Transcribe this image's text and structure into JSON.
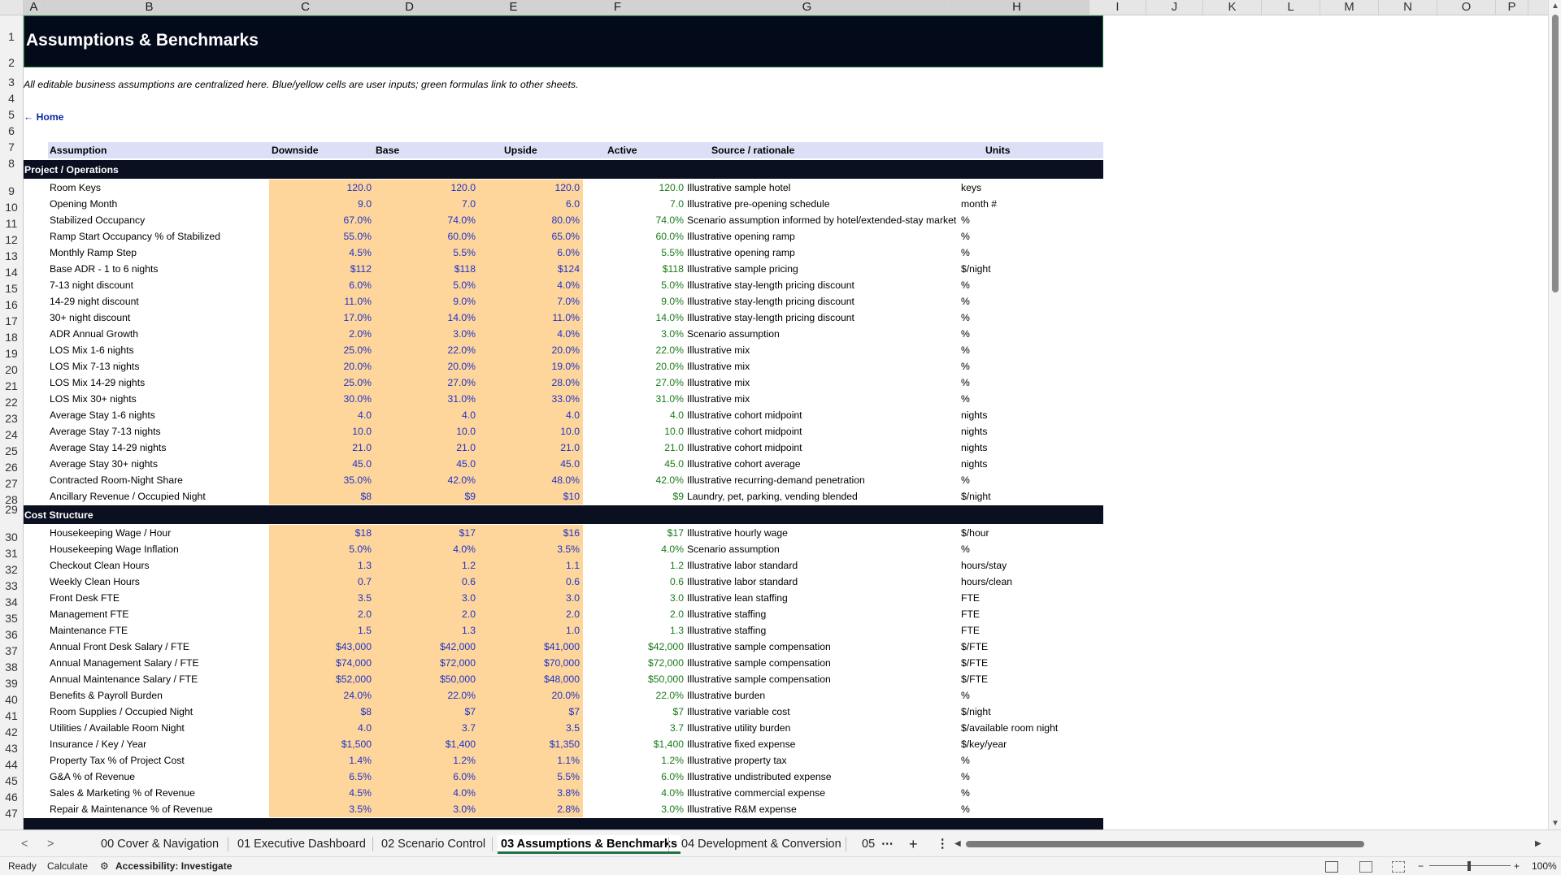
{
  "columns": [
    "A",
    "B",
    "C",
    "D",
    "E",
    "F",
    "G",
    "H",
    "I",
    "J",
    "K",
    "L",
    "M",
    "N",
    "O",
    "P"
  ],
  "title": "Assumptions & Benchmarks",
  "note": "All editable business assumptions are centralized here. Blue/yellow cells are user inputs; green formulas link to other sheets.",
  "home_link": "← Home",
  "table_headers": {
    "assumption": "Assumption",
    "downside": "Downside",
    "base": "Base",
    "upside": "Upside",
    "active": "Active",
    "source": "Source / rationale",
    "units": "Units"
  },
  "sections": {
    "ops": "Project / Operations",
    "cost": "Cost Structure"
  },
  "ops_rows": [
    {
      "row": "9",
      "name": "Room Keys",
      "down": "120.0",
      "base": "120.0",
      "up": "120.0",
      "active": "120.0",
      "source": "Illustrative sample hotel",
      "units": "keys"
    },
    {
      "row": "10",
      "name": "Opening Month",
      "down": "9.0",
      "base": "7.0",
      "up": "6.0",
      "active": "7.0",
      "source": "Illustrative pre-opening schedule",
      "units": "month #"
    },
    {
      "row": "11",
      "name": "Stabilized Occupancy",
      "down": "67.0%",
      "base": "74.0%",
      "up": "80.0%",
      "active": "74.0%",
      "source": "Scenario assumption informed by hotel/extended-stay market",
      "units": "%"
    },
    {
      "row": "12",
      "name": "Ramp Start Occupancy % of Stabilized",
      "down": "55.0%",
      "base": "60.0%",
      "up": "65.0%",
      "active": "60.0%",
      "source": "Illustrative opening ramp",
      "units": "%"
    },
    {
      "row": "13",
      "name": "Monthly Ramp Step",
      "down": "4.5%",
      "base": "5.5%",
      "up": "6.0%",
      "active": "5.5%",
      "source": "Illustrative opening ramp",
      "units": "%"
    },
    {
      "row": "14",
      "name": "Base ADR - 1 to 6 nights",
      "down": "$112",
      "base": "$118",
      "up": "$124",
      "active": "$118",
      "source": "Illustrative sample pricing",
      "units": "$/night"
    },
    {
      "row": "15",
      "name": "7-13 night discount",
      "down": "6.0%",
      "base": "5.0%",
      "up": "4.0%",
      "active": "5.0%",
      "source": "Illustrative stay-length pricing discount",
      "units": "%"
    },
    {
      "row": "16",
      "name": "14-29 night discount",
      "down": "11.0%",
      "base": "9.0%",
      "up": "7.0%",
      "active": "9.0%",
      "source": "Illustrative stay-length pricing discount",
      "units": "%"
    },
    {
      "row": "17",
      "name": "30+ night discount",
      "down": "17.0%",
      "base": "14.0%",
      "up": "11.0%",
      "active": "14.0%",
      "source": "Illustrative stay-length pricing discount",
      "units": "%"
    },
    {
      "row": "18",
      "name": "ADR Annual Growth",
      "down": "2.0%",
      "base": "3.0%",
      "up": "4.0%",
      "active": "3.0%",
      "source": "Scenario assumption",
      "units": "%"
    },
    {
      "row": "19",
      "name": "LOS Mix 1-6 nights",
      "down": "25.0%",
      "base": "22.0%",
      "up": "20.0%",
      "active": "22.0%",
      "source": "Illustrative mix",
      "units": "%"
    },
    {
      "row": "20",
      "name": "LOS Mix 7-13 nights",
      "down": "20.0%",
      "base": "20.0%",
      "up": "19.0%",
      "active": "20.0%",
      "source": "Illustrative mix",
      "units": "%"
    },
    {
      "row": "21",
      "name": "LOS Mix 14-29 nights",
      "down": "25.0%",
      "base": "27.0%",
      "up": "28.0%",
      "active": "27.0%",
      "source": "Illustrative mix",
      "units": "%"
    },
    {
      "row": "22",
      "name": "LOS Mix 30+ nights",
      "down": "30.0%",
      "base": "31.0%",
      "up": "33.0%",
      "active": "31.0%",
      "source": "Illustrative mix",
      "units": "%"
    },
    {
      "row": "23",
      "name": "Average Stay 1-6 nights",
      "down": "4.0",
      "base": "4.0",
      "up": "4.0",
      "active": "4.0",
      "source": "Illustrative cohort midpoint",
      "units": "nights"
    },
    {
      "row": "24",
      "name": "Average Stay 7-13 nights",
      "down": "10.0",
      "base": "10.0",
      "up": "10.0",
      "active": "10.0",
      "source": "Illustrative cohort midpoint",
      "units": "nights"
    },
    {
      "row": "25",
      "name": "Average Stay 14-29 nights",
      "down": "21.0",
      "base": "21.0",
      "up": "21.0",
      "active": "21.0",
      "source": "Illustrative cohort midpoint",
      "units": "nights"
    },
    {
      "row": "26",
      "name": "Average Stay 30+ nights",
      "down": "45.0",
      "base": "45.0",
      "up": "45.0",
      "active": "45.0",
      "source": "Illustrative cohort average",
      "units": "nights"
    },
    {
      "row": "27",
      "name": "Contracted Room-Night Share",
      "down": "35.0%",
      "base": "42.0%",
      "up": "48.0%",
      "active": "42.0%",
      "source": "Illustrative recurring-demand penetration",
      "units": "%"
    },
    {
      "row": "28",
      "name": "Ancillary Revenue / Occupied Night",
      "down": "$8",
      "base": "$9",
      "up": "$10",
      "active": "$9",
      "source": "Laundry, pet, parking, vending blended",
      "units": "$/night"
    }
  ],
  "cost_rows": [
    {
      "row": "30",
      "name": "Housekeeping Wage / Hour",
      "down": "$18",
      "base": "$17",
      "up": "$16",
      "active": "$17",
      "source": "Illustrative hourly wage",
      "units": "$/hour"
    },
    {
      "row": "31",
      "name": "Housekeeping Wage Inflation",
      "down": "5.0%",
      "base": "4.0%",
      "up": "3.5%",
      "active": "4.0%",
      "source": "Scenario assumption",
      "units": "%"
    },
    {
      "row": "32",
      "name": "Checkout Clean Hours",
      "down": "1.3",
      "base": "1.2",
      "up": "1.1",
      "active": "1.2",
      "source": "Illustrative labor standard",
      "units": "hours/stay"
    },
    {
      "row": "33",
      "name": "Weekly Clean Hours",
      "down": "0.7",
      "base": "0.6",
      "up": "0.6",
      "active": "0.6",
      "source": "Illustrative labor standard",
      "units": "hours/clean"
    },
    {
      "row": "34",
      "name": "Front Desk FTE",
      "down": "3.5",
      "base": "3.0",
      "up": "3.0",
      "active": "3.0",
      "source": "Illustrative lean staffing",
      "units": "FTE"
    },
    {
      "row": "35",
      "name": "Management FTE",
      "down": "2.0",
      "base": "2.0",
      "up": "2.0",
      "active": "2.0",
      "source": "Illustrative staffing",
      "units": "FTE"
    },
    {
      "row": "36",
      "name": "Maintenance FTE",
      "down": "1.5",
      "base": "1.3",
      "up": "1.0",
      "active": "1.3",
      "source": "Illustrative staffing",
      "units": "FTE"
    },
    {
      "row": "37",
      "name": "Annual Front Desk Salary / FTE",
      "down": "$43,000",
      "base": "$42,000",
      "up": "$41,000",
      "active": "$42,000",
      "source": "Illustrative sample compensation",
      "units": "$/FTE"
    },
    {
      "row": "38",
      "name": "Annual Management Salary / FTE",
      "down": "$74,000",
      "base": "$72,000",
      "up": "$70,000",
      "active": "$72,000",
      "source": "Illustrative sample compensation",
      "units": "$/FTE"
    },
    {
      "row": "39",
      "name": "Annual Maintenance Salary / FTE",
      "down": "$52,000",
      "base": "$50,000",
      "up": "$48,000",
      "active": "$50,000",
      "source": "Illustrative sample compensation",
      "units": "$/FTE"
    },
    {
      "row": "40",
      "name": "Benefits & Payroll Burden",
      "down": "24.0%",
      "base": "22.0%",
      "up": "20.0%",
      "active": "22.0%",
      "source": "Illustrative burden",
      "units": "%"
    },
    {
      "row": "41",
      "name": "Room Supplies / Occupied Night",
      "down": "$8",
      "base": "$7",
      "up": "$7",
      "active": "$7",
      "source": "Illustrative variable cost",
      "units": "$/night"
    },
    {
      "row": "42",
      "name": "Utilities / Available Room Night",
      "down": "4.0",
      "base": "3.7",
      "up": "3.5",
      "active": "3.7",
      "source": "Illustrative utility burden",
      "units": "$/available room night"
    },
    {
      "row": "43",
      "name": "Insurance / Key / Year",
      "down": "$1,500",
      "base": "$1,400",
      "up": "$1,350",
      "active": "$1,400",
      "source": "Illustrative fixed expense",
      "units": "$/key/year"
    },
    {
      "row": "44",
      "name": "Property Tax % of Project Cost",
      "down": "1.4%",
      "base": "1.2%",
      "up": "1.1%",
      "active": "1.2%",
      "source": "Illustrative property tax",
      "units": "%"
    },
    {
      "row": "45",
      "name": "G&A % of Revenue",
      "down": "6.5%",
      "base": "6.0%",
      "up": "5.5%",
      "active": "6.0%",
      "source": "Illustrative undistributed expense",
      "units": "%"
    },
    {
      "row": "46",
      "name": "Sales & Marketing % of Revenue",
      "down": "4.5%",
      "base": "4.0%",
      "up": "3.8%",
      "active": "4.0%",
      "source": "Illustrative commercial expense",
      "units": "%"
    },
    {
      "row": "47",
      "name": "Repair & Maintenance % of Revenue",
      "down": "3.5%",
      "base": "3.0%",
      "up": "2.8%",
      "active": "3.0%",
      "source": "Illustrative R&M expense",
      "units": "%"
    }
  ],
  "tabs": [
    "00 Cover & Navigation",
    "01 Executive Dashboard",
    "02 Scenario Control",
    "03 Assumptions & Benchmarks",
    "04 Development & Conversion",
    "05"
  ],
  "status": {
    "ready": "Ready",
    "calculate": "Calculate",
    "accessibility": "Accessibility: Investigate",
    "zoom": "100%"
  }
}
